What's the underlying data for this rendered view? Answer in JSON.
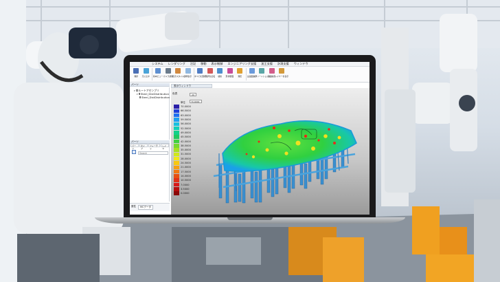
{
  "menu": {
    "items": [
      "システム",
      "レンダリング",
      "注記",
      "移動",
      "表示制御",
      "エンジニアリング支援",
      "加工支援",
      "計測支援",
      "ウィンドウ"
    ]
  },
  "ribbon": {
    "buttons": [
      {
        "label": "保存",
        "icon": "save-icon",
        "color": "#4a6fb5"
      },
      {
        "label": "元に戻す",
        "icon": "undo-icon",
        "color": "#4aa3d8"
      },
      {
        "label": "基本ビュー",
        "icon": "cube-icon",
        "color": "#5d8fd1"
      },
      {
        "label": "カメラ調整",
        "icon": "camera-icon",
        "color": "#6b7b8c"
      },
      {
        "label": "表示スタイル",
        "icon": "render-style-icon",
        "color": "#d1883f"
      },
      {
        "label": "透明表示",
        "icon": "transparency-icon",
        "color": "#8fb7e0"
      },
      {
        "label": "すべてを選択",
        "icon": "select-all-icon",
        "color": "#4f7cc4"
      },
      {
        "label": "選択を反転",
        "icon": "invert-selection-icon",
        "color": "#d45858"
      },
      {
        "label": "検索",
        "icon": "search-icon",
        "color": "#4c8fcf"
      },
      {
        "label": "形状断面",
        "icon": "section-icon",
        "color": "#c74c9a"
      },
      {
        "label": "測定",
        "icon": "measure-icon",
        "color": "#e0a030"
      },
      {
        "label": "全画面表示",
        "icon": "fullscreen-icon",
        "color": "#6a9adb"
      },
      {
        "label": "スクリーンショット",
        "icon": "screenshot-icon",
        "color": "#5aa6a6"
      },
      {
        "label": "範囲指定",
        "icon": "range-icon",
        "color": "#d35d8a"
      },
      {
        "label": "レイヤーを表示",
        "icon": "layers-icon",
        "color": "#d49a3a"
      }
    ]
  },
  "tree": {
    "header": "パーツ",
    "root": "ルートアセンブリ",
    "child1": "Steel_DistDistribution",
    "child2": "Steel_DistDistribution"
  },
  "parts": {
    "header": "パーツ",
    "search_placeholder": "Search",
    "tabs": [
      "パーツ",
      "タイプ",
      "フィーチャ",
      "レイヤ"
    ]
  },
  "properties": {
    "label": "属性",
    "value": "MCデータ"
  },
  "viewport": {
    "tab_label": "表示ウィンドウ"
  },
  "legend": {
    "title": "色表",
    "count": "20",
    "unit_label": "単位",
    "unit_value": "70.0000",
    "values": [
      "70.0000",
      "66.5000",
      "63.0000",
      "59.5000",
      "56.0000",
      "52.5000",
      "49.0000",
      "45.5000",
      "42.0000",
      "38.5000",
      "35.0000",
      "31.5000",
      "28.0000",
      "24.5000",
      "21.0000",
      "17.5000",
      "14.0000",
      "10.5000",
      "7.0000",
      "3.5000",
      "0.0000"
    ],
    "colors": [
      "#2a1fa8",
      "#1f3fd8",
      "#1f6ff0",
      "#1fa0f0",
      "#18c0e0",
      "#12d0b8",
      "#12d08a",
      "#20c860",
      "#40d040",
      "#78d830",
      "#a8e020",
      "#d0e818",
      "#f0e818",
      "#f8c810",
      "#f8a010",
      "#f07810",
      "#e85010",
      "#e03018",
      "#d81818",
      "#b80c0c",
      "#8a0808"
    ]
  }
}
